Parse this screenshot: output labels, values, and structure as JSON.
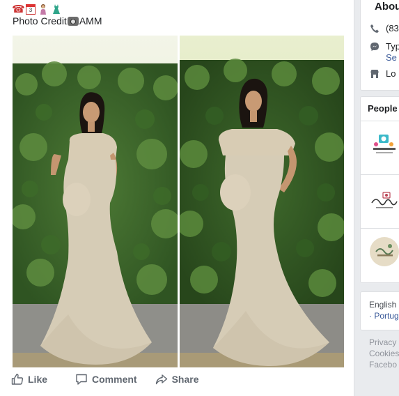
{
  "post": {
    "emojis": [
      "phone-emoji",
      "calendar-emoji",
      "woman-emoji",
      "dress-emoji"
    ],
    "calendar_day": "3",
    "credit_prefix": "Photo Credit",
    "credit_suffix": "AMM",
    "actions": {
      "like": "Like",
      "comment": "Comment",
      "share": "Share"
    }
  },
  "sidebar": {
    "about_title": "About",
    "phone": "(83",
    "message": "Typ",
    "message_link": "Se",
    "location": "Lo",
    "people_title": "People A",
    "languages": [
      "English",
      "· Portug"
    ],
    "footer": [
      "Privacy ·",
      "Cookies",
      "Facebo"
    ]
  },
  "colors": {
    "link": "#385898",
    "action_text": "#606770",
    "background": "#e9ebee"
  }
}
